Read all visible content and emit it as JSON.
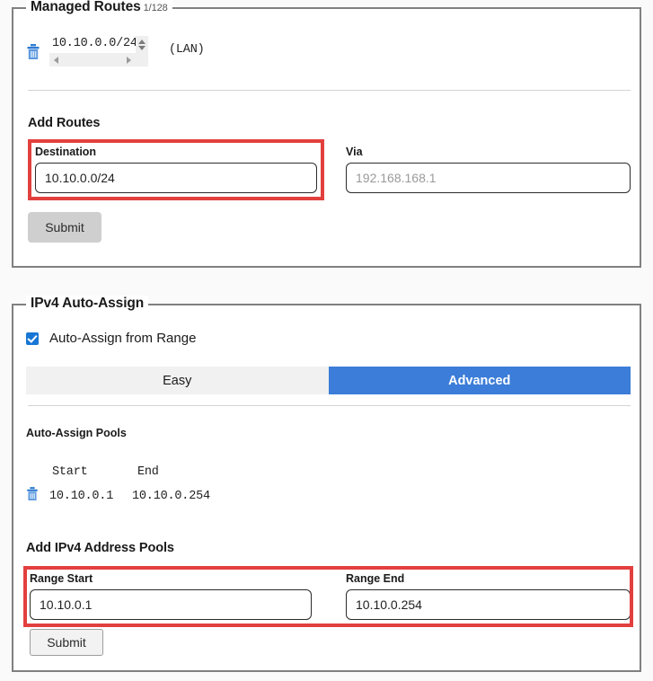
{
  "routes_panel": {
    "legend": "Managed Routes",
    "count": "1/128",
    "entries": [
      {
        "target": "10.10.0.0/24",
        "tag": "(LAN)",
        "delete_icon": "trash-icon"
      }
    ],
    "add_section_title": "Add Routes",
    "destination": {
      "label": "Destination",
      "value": "10.10.0.0/24",
      "placeholder": "10.10.0.0/24"
    },
    "via": {
      "label": "Via",
      "value": "",
      "placeholder": "192.168.168.1"
    },
    "submit_label": "Submit",
    "highlight_color": "#e2403e"
  },
  "ipv4_panel": {
    "legend": "IPv4 Auto-Assign",
    "auto_assign_checkbox": {
      "label": "Auto-Assign from Range",
      "checked": true,
      "color": "#1877d4"
    },
    "tabs": [
      {
        "label": "Easy",
        "active": false
      },
      {
        "label": "Advanced",
        "active": true
      }
    ],
    "active_tab_color": "#3b7dd8",
    "pools_title": "Auto-Assign Pools",
    "pools_columns": [
      "Start",
      "End"
    ],
    "pools_rows": [
      {
        "start": "10.10.0.1",
        "end": "10.10.0.254",
        "delete_icon": "trash-icon"
      }
    ],
    "add_pools_title": "Add IPv4 Address Pools",
    "range_start": {
      "label": "Range Start",
      "value": "10.10.0.1",
      "placeholder": "10.10.0.1"
    },
    "range_end": {
      "label": "Range End",
      "value": "10.10.0.254",
      "placeholder": "10.10.0.254"
    },
    "submit_label": "Submit",
    "highlight_color": "#e2403e"
  }
}
